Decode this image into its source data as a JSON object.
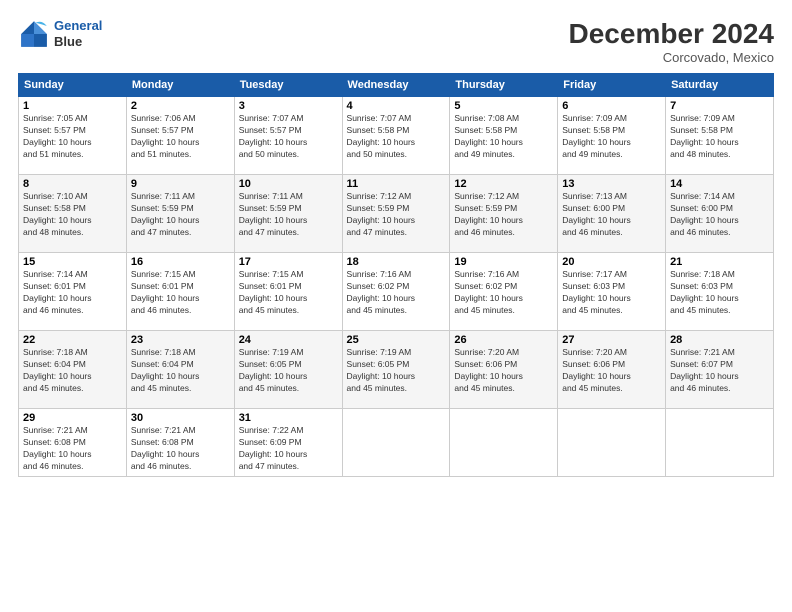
{
  "header": {
    "logo_line1": "General",
    "logo_line2": "Blue",
    "month": "December 2024",
    "location": "Corcovado, Mexico"
  },
  "days_of_week": [
    "Sunday",
    "Monday",
    "Tuesday",
    "Wednesday",
    "Thursday",
    "Friday",
    "Saturday"
  ],
  "weeks": [
    [
      {
        "day": "1",
        "info": "Sunrise: 7:05 AM\nSunset: 5:57 PM\nDaylight: 10 hours\nand 51 minutes."
      },
      {
        "day": "2",
        "info": "Sunrise: 7:06 AM\nSunset: 5:57 PM\nDaylight: 10 hours\nand 51 minutes."
      },
      {
        "day": "3",
        "info": "Sunrise: 7:07 AM\nSunset: 5:57 PM\nDaylight: 10 hours\nand 50 minutes."
      },
      {
        "day": "4",
        "info": "Sunrise: 7:07 AM\nSunset: 5:58 PM\nDaylight: 10 hours\nand 50 minutes."
      },
      {
        "day": "5",
        "info": "Sunrise: 7:08 AM\nSunset: 5:58 PM\nDaylight: 10 hours\nand 49 minutes."
      },
      {
        "day": "6",
        "info": "Sunrise: 7:09 AM\nSunset: 5:58 PM\nDaylight: 10 hours\nand 49 minutes."
      },
      {
        "day": "7",
        "info": "Sunrise: 7:09 AM\nSunset: 5:58 PM\nDaylight: 10 hours\nand 48 minutes."
      }
    ],
    [
      {
        "day": "8",
        "info": "Sunrise: 7:10 AM\nSunset: 5:58 PM\nDaylight: 10 hours\nand 48 minutes."
      },
      {
        "day": "9",
        "info": "Sunrise: 7:11 AM\nSunset: 5:59 PM\nDaylight: 10 hours\nand 47 minutes."
      },
      {
        "day": "10",
        "info": "Sunrise: 7:11 AM\nSunset: 5:59 PM\nDaylight: 10 hours\nand 47 minutes."
      },
      {
        "day": "11",
        "info": "Sunrise: 7:12 AM\nSunset: 5:59 PM\nDaylight: 10 hours\nand 47 minutes."
      },
      {
        "day": "12",
        "info": "Sunrise: 7:12 AM\nSunset: 5:59 PM\nDaylight: 10 hours\nand 46 minutes."
      },
      {
        "day": "13",
        "info": "Sunrise: 7:13 AM\nSunset: 6:00 PM\nDaylight: 10 hours\nand 46 minutes."
      },
      {
        "day": "14",
        "info": "Sunrise: 7:14 AM\nSunset: 6:00 PM\nDaylight: 10 hours\nand 46 minutes."
      }
    ],
    [
      {
        "day": "15",
        "info": "Sunrise: 7:14 AM\nSunset: 6:01 PM\nDaylight: 10 hours\nand 46 minutes."
      },
      {
        "day": "16",
        "info": "Sunrise: 7:15 AM\nSunset: 6:01 PM\nDaylight: 10 hours\nand 46 minutes."
      },
      {
        "day": "17",
        "info": "Sunrise: 7:15 AM\nSunset: 6:01 PM\nDaylight: 10 hours\nand 45 minutes."
      },
      {
        "day": "18",
        "info": "Sunrise: 7:16 AM\nSunset: 6:02 PM\nDaylight: 10 hours\nand 45 minutes."
      },
      {
        "day": "19",
        "info": "Sunrise: 7:16 AM\nSunset: 6:02 PM\nDaylight: 10 hours\nand 45 minutes."
      },
      {
        "day": "20",
        "info": "Sunrise: 7:17 AM\nSunset: 6:03 PM\nDaylight: 10 hours\nand 45 minutes."
      },
      {
        "day": "21",
        "info": "Sunrise: 7:18 AM\nSunset: 6:03 PM\nDaylight: 10 hours\nand 45 minutes."
      }
    ],
    [
      {
        "day": "22",
        "info": "Sunrise: 7:18 AM\nSunset: 6:04 PM\nDaylight: 10 hours\nand 45 minutes."
      },
      {
        "day": "23",
        "info": "Sunrise: 7:18 AM\nSunset: 6:04 PM\nDaylight: 10 hours\nand 45 minutes."
      },
      {
        "day": "24",
        "info": "Sunrise: 7:19 AM\nSunset: 6:05 PM\nDaylight: 10 hours\nand 45 minutes."
      },
      {
        "day": "25",
        "info": "Sunrise: 7:19 AM\nSunset: 6:05 PM\nDaylight: 10 hours\nand 45 minutes."
      },
      {
        "day": "26",
        "info": "Sunrise: 7:20 AM\nSunset: 6:06 PM\nDaylight: 10 hours\nand 45 minutes."
      },
      {
        "day": "27",
        "info": "Sunrise: 7:20 AM\nSunset: 6:06 PM\nDaylight: 10 hours\nand 45 minutes."
      },
      {
        "day": "28",
        "info": "Sunrise: 7:21 AM\nSunset: 6:07 PM\nDaylight: 10 hours\nand 46 minutes."
      }
    ],
    [
      {
        "day": "29",
        "info": "Sunrise: 7:21 AM\nSunset: 6:08 PM\nDaylight: 10 hours\nand 46 minutes."
      },
      {
        "day": "30",
        "info": "Sunrise: 7:21 AM\nSunset: 6:08 PM\nDaylight: 10 hours\nand 46 minutes."
      },
      {
        "day": "31",
        "info": "Sunrise: 7:22 AM\nSunset: 6:09 PM\nDaylight: 10 hours\nand 47 minutes."
      },
      {
        "day": "",
        "info": ""
      },
      {
        "day": "",
        "info": ""
      },
      {
        "day": "",
        "info": ""
      },
      {
        "day": "",
        "info": ""
      }
    ]
  ]
}
